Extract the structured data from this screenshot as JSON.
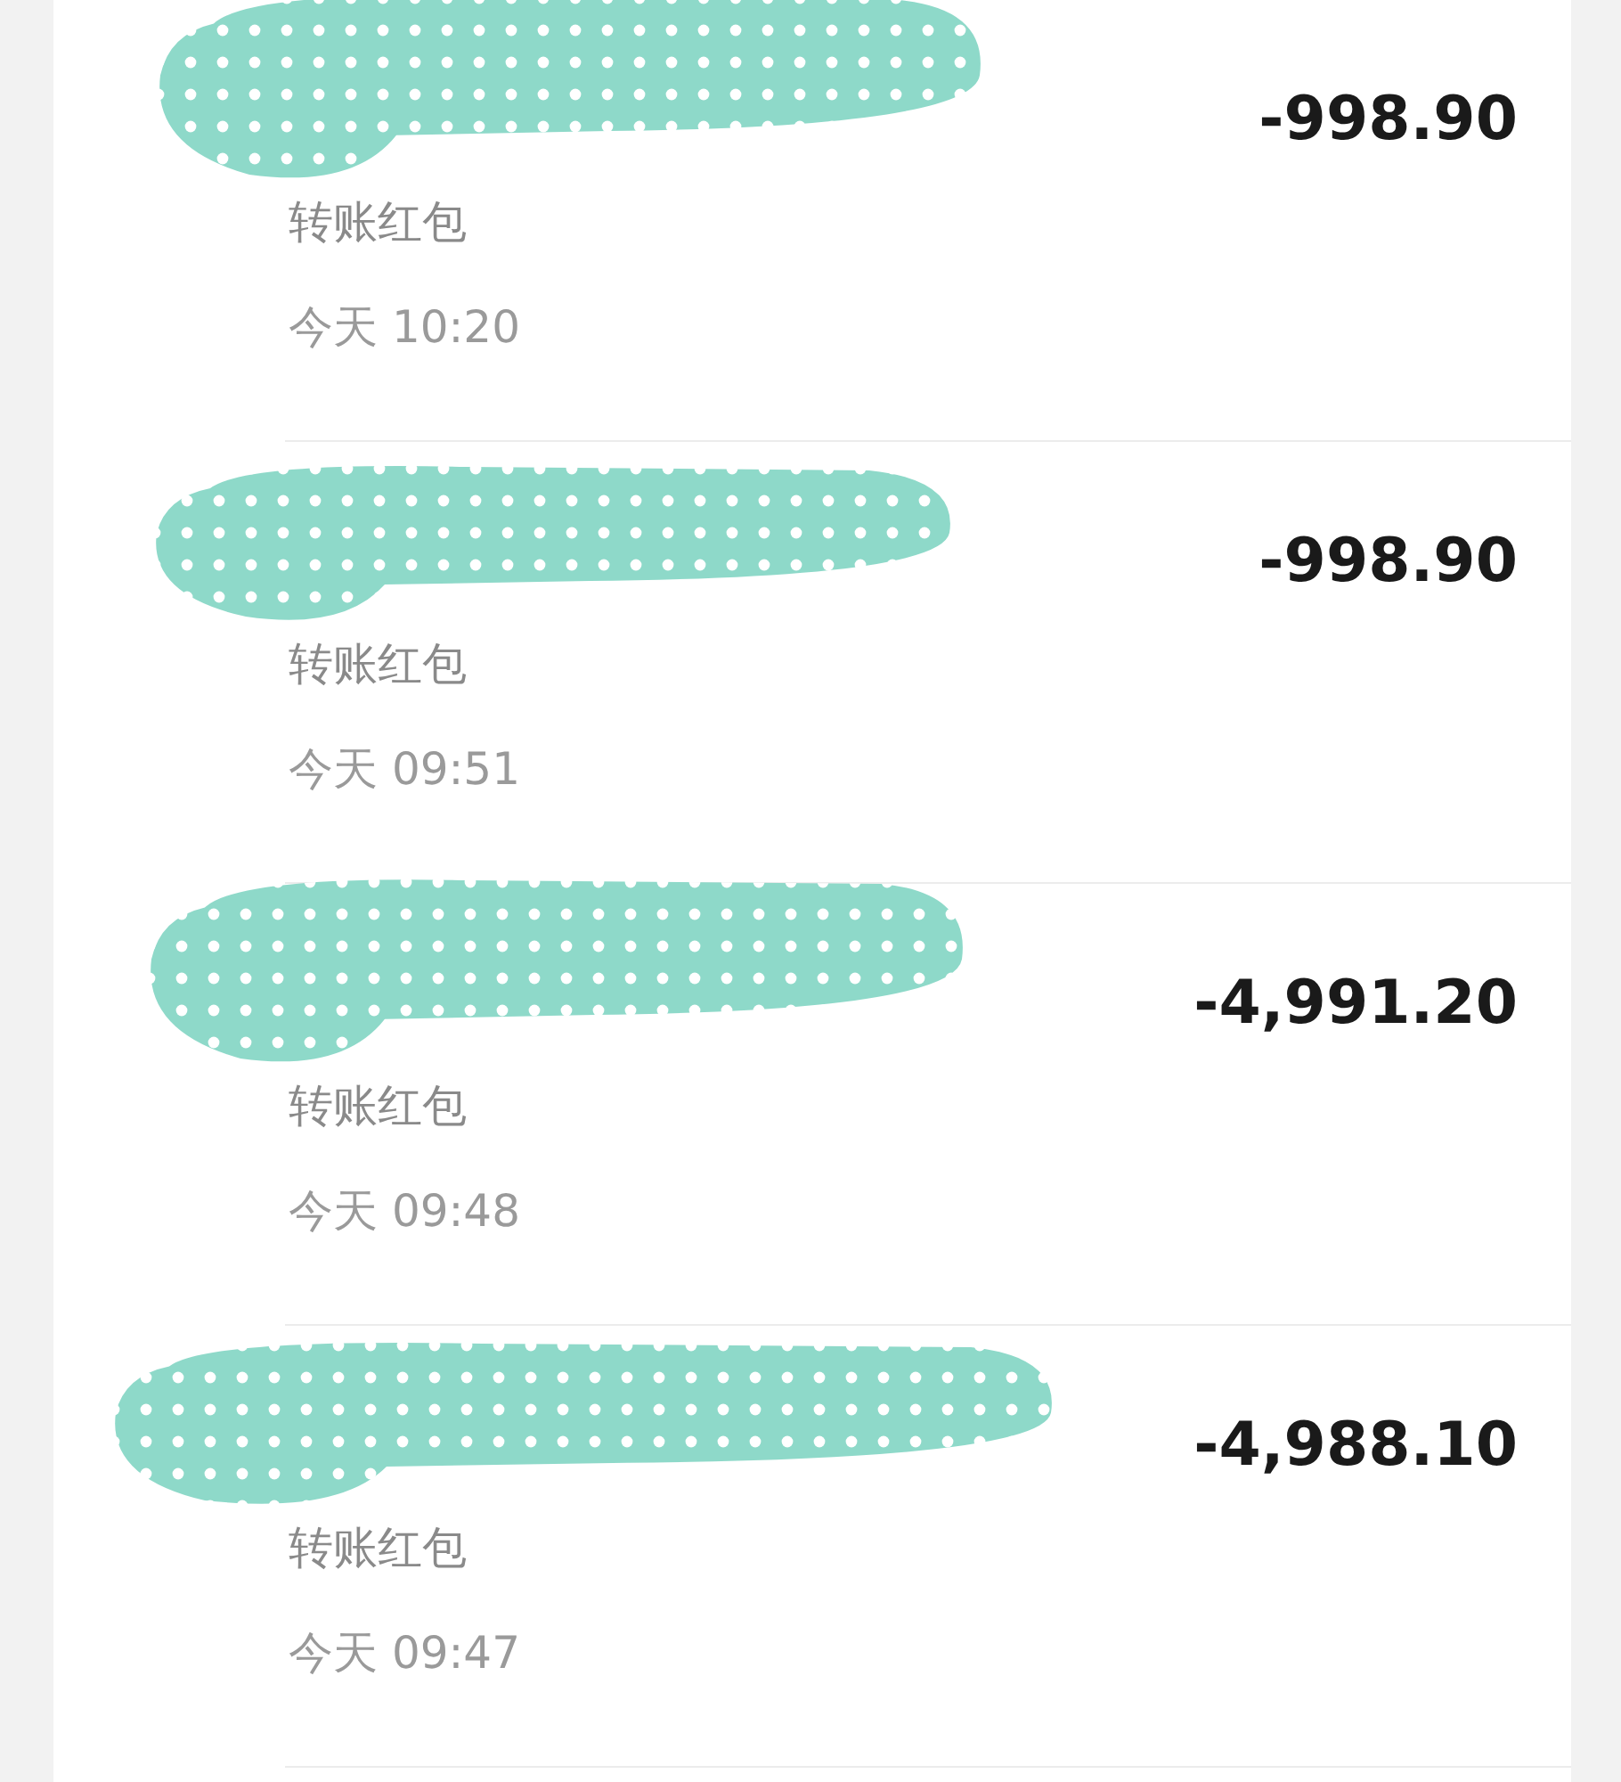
{
  "transactions": [
    {
      "amount": "-998.90",
      "label": "转账红包",
      "time": "今天 10:20"
    },
    {
      "amount": "-998.90",
      "label": "转账红包",
      "time": "今天 09:51"
    },
    {
      "amount": "-4,991.20",
      "label": "转账红包",
      "time": "今天 09:48"
    },
    {
      "amount": "-4,988.10",
      "label": "转账红包",
      "time": "今天 09:47"
    }
  ]
}
